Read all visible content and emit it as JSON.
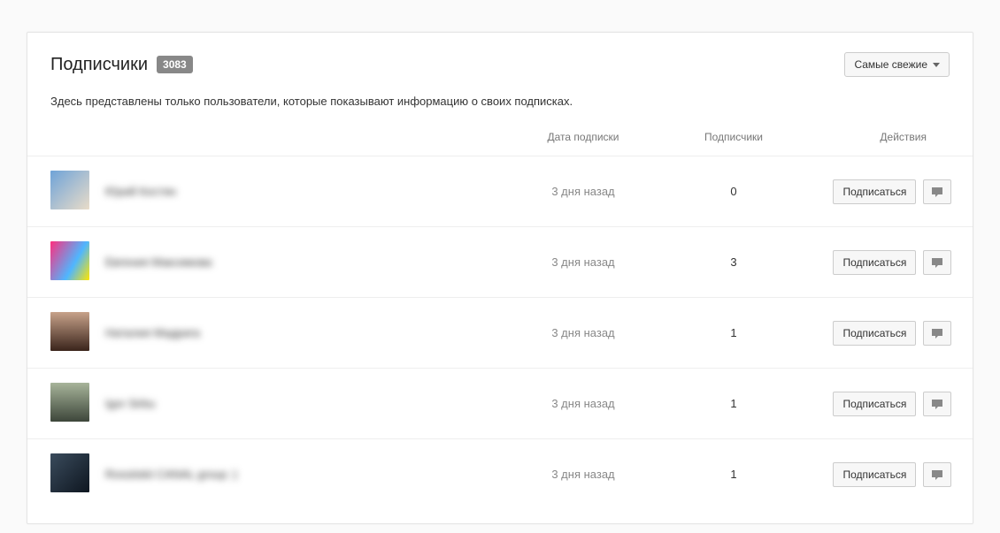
{
  "header": {
    "title": "Подписчики",
    "count": "3083",
    "filter_label": "Самые свежие"
  },
  "description": "Здесь представлены только пользователи, которые показывают информацию о своих подписках.",
  "columns": {
    "date": "Дата подписки",
    "subs": "Подписчики",
    "actions": "Действия"
  },
  "actions": {
    "subscribe": "Подписаться"
  },
  "rows": [
    {
      "name": "Юрий Костян",
      "date": "3 дня назад",
      "subs": "0"
    },
    {
      "name": "Евгения Максимова",
      "date": "3 дня назад",
      "subs": "3"
    },
    {
      "name": "Наталия Мадрига",
      "date": "3 дня назад",
      "subs": "1"
    },
    {
      "name": "Igor Sirbu",
      "date": "3 дня назад",
      "subs": "1"
    },
    {
      "name": "Rossiiskii CANAL group :)",
      "date": "3 дня назад",
      "subs": "1"
    }
  ]
}
